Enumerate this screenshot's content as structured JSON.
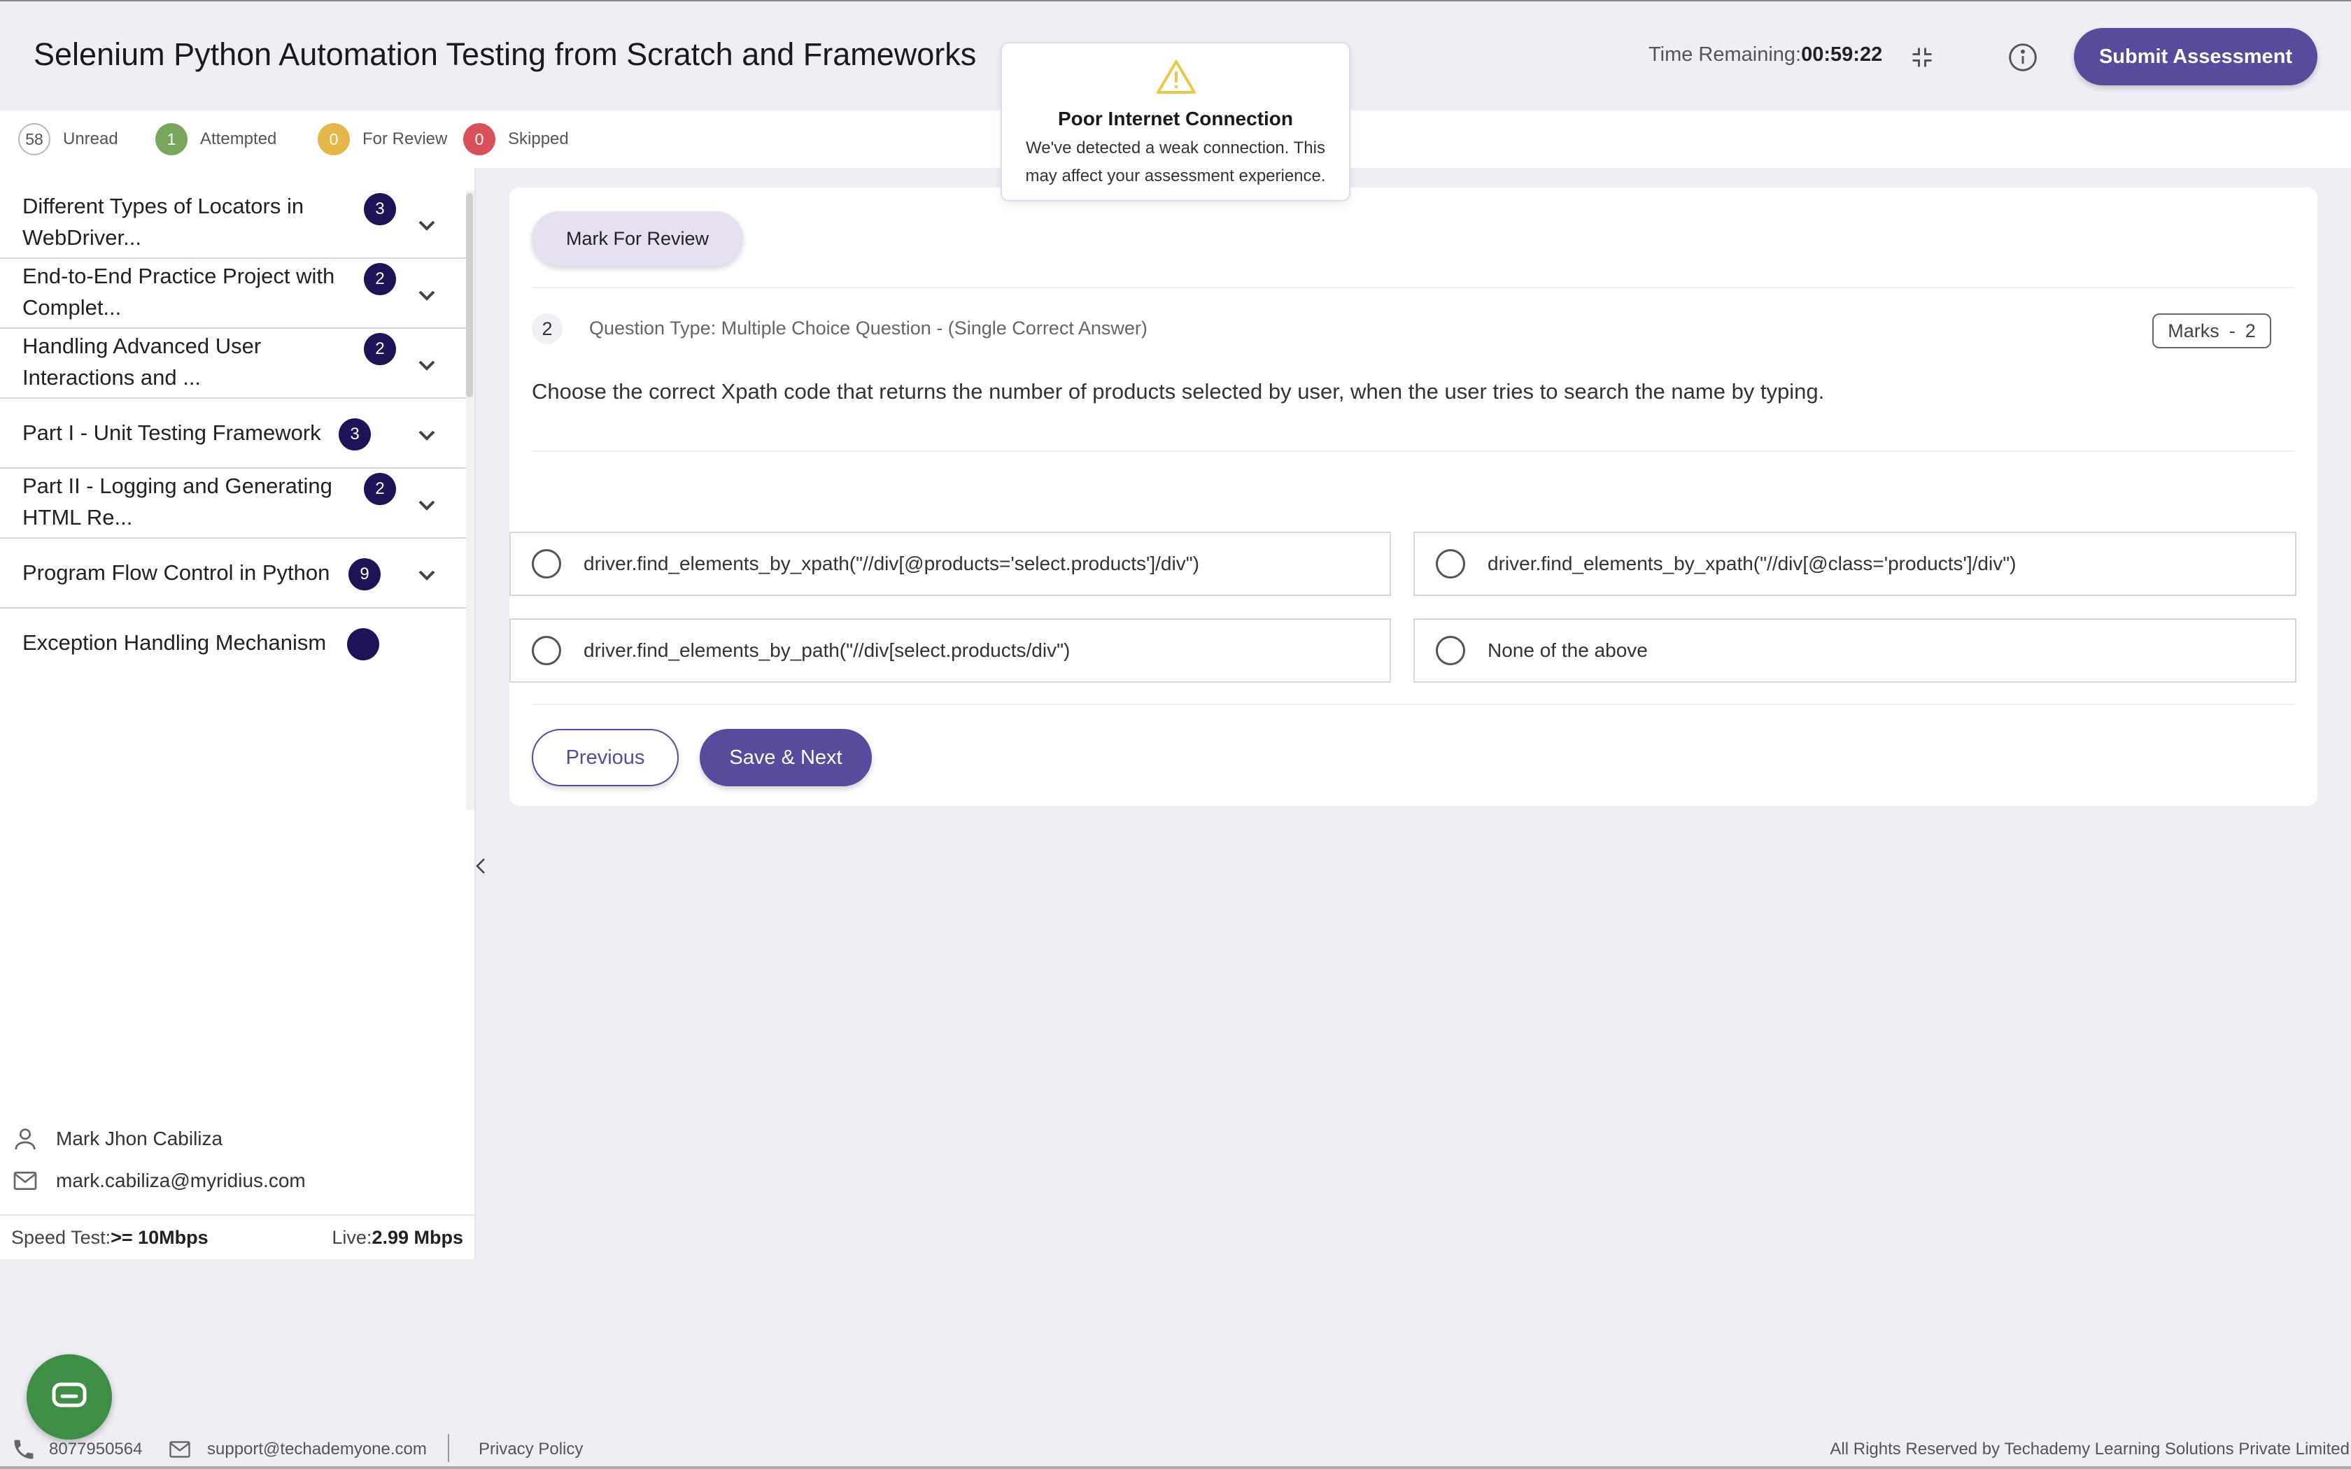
{
  "header": {
    "title": "Selenium Python Automation Testing from Scratch and Frameworks",
    "time_label": "Time Remaining:",
    "time_value": "00:59:22",
    "submit_label": "Submit Assessment"
  },
  "toast": {
    "title": "Poor Internet Connection",
    "message_line1": "We've detected a weak connection. This",
    "message_line2": "may affect your assessment experience.",
    "icon_color": "#e8c94a"
  },
  "status": {
    "unread": {
      "count": "58",
      "label": "Unread",
      "color": "#ffffff"
    },
    "attempted": {
      "count": "1",
      "label": "Attempted",
      "color": "#7aa55c"
    },
    "for_review": {
      "count": "0",
      "label": "For Review",
      "color": "#e6b64a"
    },
    "skipped": {
      "count": "0",
      "label": "Skipped",
      "color": "#d9505a"
    }
  },
  "sections": [
    {
      "line1": "Different Types of Locators in",
      "line2": "WebDriver...",
      "count": "3"
    },
    {
      "line1": "End-to-End Practice Project with",
      "line2": "Complet...",
      "count": "2"
    },
    {
      "line1": "Handling Advanced User",
      "line2": "Interactions and ...",
      "count": "2"
    },
    {
      "line1": "Part I - Unit Testing Framework",
      "line2": "",
      "count": "3"
    },
    {
      "line1": "Part II - Logging and Generating",
      "line2": "HTML Re...",
      "count": "2"
    },
    {
      "line1": "Program Flow Control in Python",
      "line2": "",
      "count": "9"
    },
    {
      "line1": "Exception Handling Mechanism",
      "line2": "",
      "count": ""
    }
  ],
  "user": {
    "name": "Mark Jhon Cabiliza",
    "email": "mark.cabiliza@myridius.com"
  },
  "speed": {
    "test_label": "Speed Test:",
    "test_value": ">= 10Mbps",
    "live_label": "Live:",
    "live_value": "2.99 Mbps"
  },
  "question": {
    "mark_review_label": "Mark For Review",
    "number": "2",
    "type": "Question Type: Multiple Choice Question -  (Single Correct Answer)",
    "marks_label": "Marks",
    "marks_sep": "-",
    "marks_value": "2",
    "text": "Choose the correct Xpath code that returns the number of products selected by user, when the user tries to search the name by typing.",
    "options": [
      "driver.find_elements_by_xpath(\"//div[@products='select.products']/div\")",
      "driver.find_elements_by_xpath(\"//div[@class='products']/div\")",
      "driver.find_elements_by_path(\"//div[select.products/div\")",
      "None of the above"
    ],
    "previous_label": "Previous",
    "next_label": "Save & Next"
  },
  "footer": {
    "phone": "8077950564",
    "email": "support@techademyone.com",
    "privacy": "Privacy Policy",
    "rights": "All Rights Reserved by Techademy Learning Solutions Private Limited"
  },
  "colors": {
    "primary": "#5a4a9e",
    "badge": "#1f1256",
    "chat": "#3e8f45"
  }
}
